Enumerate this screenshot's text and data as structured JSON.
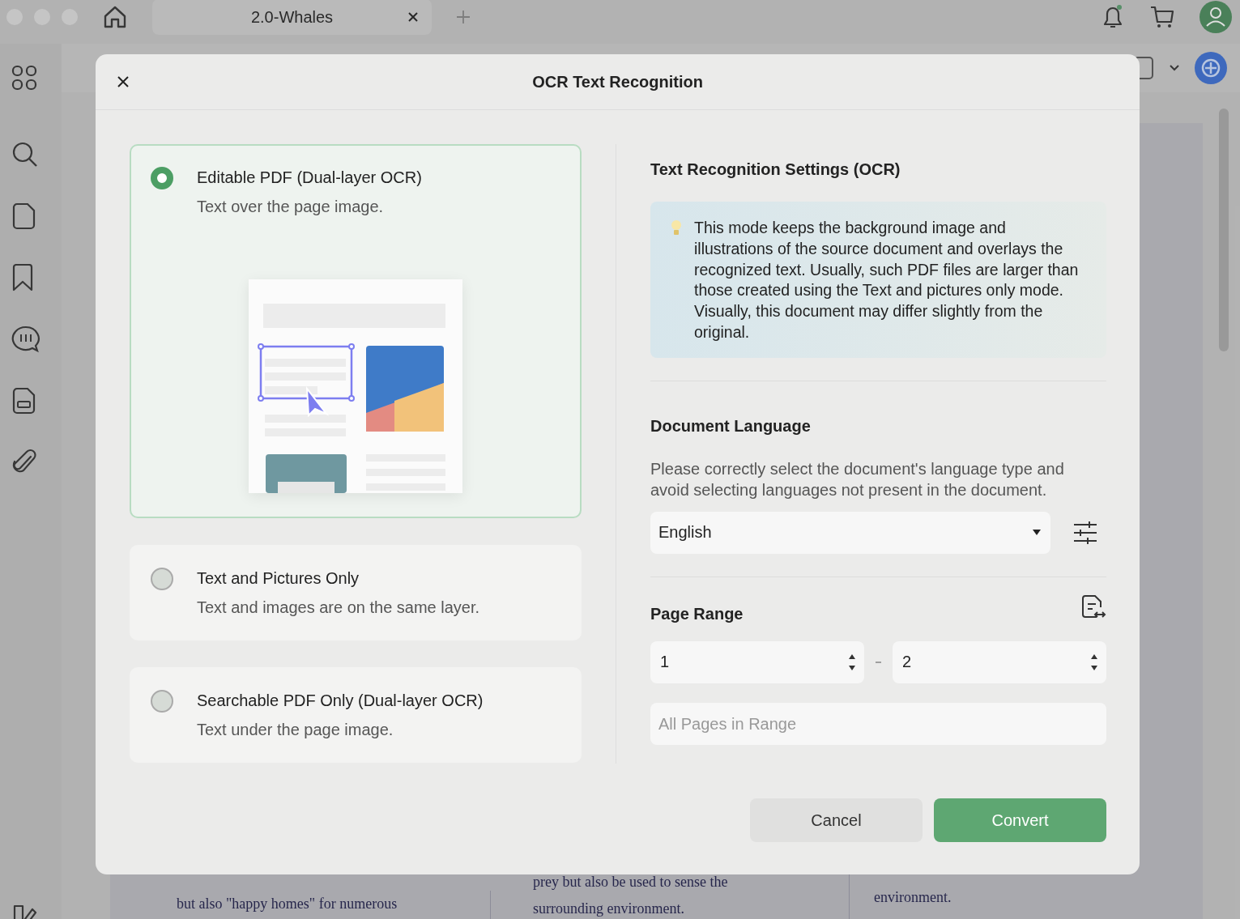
{
  "top_bar": {
    "tab": {
      "title": "2.0-Whales"
    }
  },
  "document": {
    "columns": [
      {
        "lines": [
          "but also \"happy homes\" for numerous"
        ]
      },
      {
        "lines": [
          "prey but also be used to sense the",
          "surrounding environment."
        ]
      },
      {
        "lines": [
          "environment."
        ]
      }
    ]
  },
  "dialog": {
    "title": "OCR Text Recognition",
    "modes": [
      {
        "title": "Editable PDF (Dual-layer OCR)",
        "description": "Text over the page image.",
        "selected": true
      },
      {
        "title": "Text and Pictures Only",
        "description": "Text and images are on the same layer.",
        "selected": false
      },
      {
        "title": "Searchable PDF Only (Dual-layer OCR)",
        "description": "Text under the page image.",
        "selected": false
      }
    ],
    "settings": {
      "heading": "Text Recognition Settings (OCR)",
      "note": "This mode keeps the background image and illustrations of the source document and overlays the recognized text. Usually, such PDF files are larger than those created using the Text and pictures only mode. Visually, this document may differ slightly from the original.",
      "language": {
        "heading": "Document Language",
        "description": "Please correctly select the document's language type and avoid selecting languages not present in the document.",
        "value": "English"
      },
      "page_range": {
        "heading": "Page Range",
        "from": "1",
        "to": "2",
        "subset": "All Pages in Range"
      }
    },
    "buttons": [
      {
        "label": "Cancel",
        "kind": "secondary"
      },
      {
        "label": "Convert",
        "kind": "primary"
      }
    ]
  }
}
